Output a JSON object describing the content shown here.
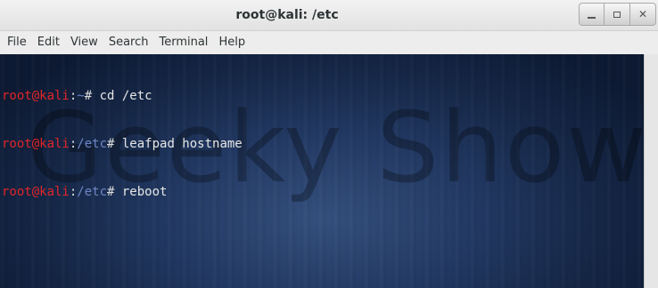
{
  "window": {
    "title": "root@kali: /etc",
    "buttons": {
      "minimize_icon": "minimize-icon",
      "maximize_icon": "maximize-icon",
      "close_glyph": "✕"
    }
  },
  "menubar": {
    "items": [
      "File",
      "Edit",
      "View",
      "Search",
      "Terminal",
      "Help"
    ]
  },
  "terminal": {
    "watermark": "Geeky Show",
    "lines": [
      {
        "user": "root@kali",
        "colon": ":",
        "path": "~",
        "prompt": "# ",
        "command": "cd /etc"
      },
      {
        "user": "root@kali",
        "colon": ":",
        "path": "/etc",
        "prompt": "# ",
        "command": "leafpad hostname"
      },
      {
        "user": "root@kali",
        "colon": ":",
        "path": "/etc",
        "prompt": "# ",
        "command": "reboot"
      }
    ]
  },
  "colors": {
    "user": "#e0262a",
    "path": "#6e86c6",
    "text": "#e6e6e6",
    "background": "#1b2e52"
  }
}
